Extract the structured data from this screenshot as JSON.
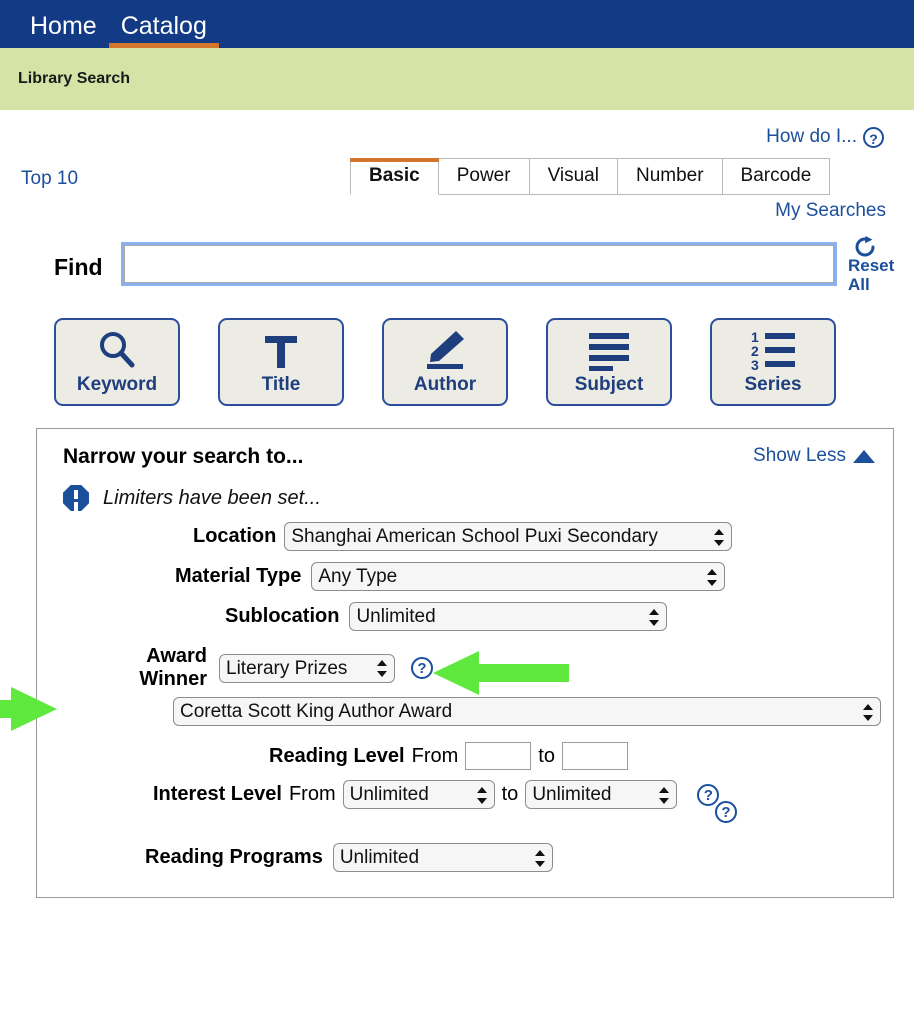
{
  "top_nav": {
    "items": [
      {
        "label": "Home",
        "active": false
      },
      {
        "label": "Catalog",
        "active": true
      }
    ]
  },
  "page_band": {
    "title": "Library Search"
  },
  "header": {
    "how_do_i_label": "How do I...",
    "how_do_i_icon": "question-circle-icon",
    "top10_label": "Top 10",
    "my_searches_label": "My Searches"
  },
  "search_tabs": [
    {
      "label": "Basic",
      "active": true
    },
    {
      "label": "Power",
      "active": false
    },
    {
      "label": "Visual",
      "active": false
    },
    {
      "label": "Number",
      "active": false
    },
    {
      "label": "Barcode",
      "active": false
    }
  ],
  "find": {
    "label": "Find",
    "value": "",
    "placeholder": "",
    "reset_line1": "Reset",
    "reset_line2": "All",
    "reset_icon": "refresh-circular-arrow-icon"
  },
  "search_buttons": [
    {
      "label": "Keyword",
      "icon": "magnifying-glass-icon"
    },
    {
      "label": "Title",
      "icon": "letter-t-icon"
    },
    {
      "label": "Author",
      "icon": "pencil-underline-icon"
    },
    {
      "label": "Subject",
      "icon": "lines-list-icon"
    },
    {
      "label": "Series",
      "icon": "numbered-list-icon"
    }
  ],
  "narrow_panel": {
    "title": "Narrow your search to...",
    "show_less_label": "Show Less",
    "show_less_icon": "triangle-up-icon",
    "limiters_icon": "alert-octagon-icon",
    "limiters_text": "Limiters have been set...",
    "location": {
      "label": "Location",
      "value": "Shanghai American School Puxi Secondary"
    },
    "material_type": {
      "label": "Material Type",
      "value": "Any Type"
    },
    "sublocation": {
      "label": "Sublocation",
      "value": "Unlimited"
    },
    "award_winner": {
      "label_line1": "Award",
      "label_line2": "Winner",
      "category_value": "Literary Prizes",
      "help_icon": "question-circle-icon",
      "award_value": "Coretta Scott King Author Award"
    },
    "reading_level": {
      "label": "Reading Level",
      "from_label": "From",
      "to_label": "to",
      "from_value": "",
      "to_value": ""
    },
    "interest_level": {
      "label": "Interest Level",
      "from_label": "From",
      "to_label": "to",
      "from_value": "Unlimited",
      "to_value": "Unlimited",
      "help_icon": "question-circle-icon"
    },
    "reading_programs": {
      "label": "Reading Programs",
      "value": "Unlimited",
      "help_icon": "question-circle-icon"
    }
  },
  "annotations": {
    "arrow_color": "#5FE93F",
    "arrows": [
      {
        "name": "arrow-pointing-to-award-category-help",
        "direction": "left"
      },
      {
        "name": "arrow-pointing-to-award-select",
        "direction": "right"
      }
    ]
  },
  "colors": {
    "nav_blue": "#133A85",
    "band_green": "#D5E3A6",
    "accent_orange": "#D2762B",
    "link_blue": "#1B4F9C",
    "button_face": "#ECECE5",
    "button_border": "#2B4F9E"
  }
}
